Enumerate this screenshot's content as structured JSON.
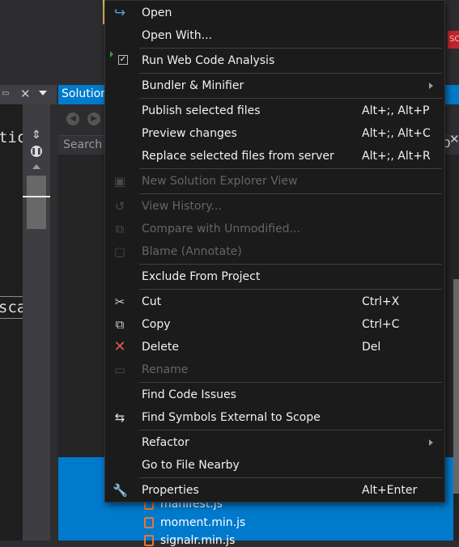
{
  "background": {
    "top_tab_label": "SC",
    "solution_explorer_title": "Solution",
    "search_placeholder": "Search S",
    "editor_text_1": "tic",
    "editor_text_2": "sca",
    "right_char": "p",
    "files": [
      "manifest.js",
      "moment.min.js",
      "signalr.min.js"
    ]
  },
  "menu": {
    "items": [
      {
        "id": "open",
        "label": "Open",
        "icon": "open-arrow-icon",
        "enabled": true
      },
      {
        "id": "open-with",
        "label": "Open With...",
        "enabled": true
      },
      {
        "id": "run-web-code-analysis",
        "label": "Run Web Code Analysis",
        "icon": "checkbox-icon",
        "enabled": true
      },
      {
        "id": "bundler-minifier",
        "label": "Bundler & Minifier",
        "submenu": true,
        "enabled": true
      },
      {
        "id": "publish-selected-files",
        "label": "Publish selected files",
        "shortcut": "Alt+;, Alt+P",
        "enabled": true
      },
      {
        "id": "preview-changes",
        "label": "Preview changes",
        "shortcut": "Alt+;, Alt+C",
        "enabled": true
      },
      {
        "id": "replace-selected-files",
        "label": "Replace selected files from server",
        "shortcut": "Alt+;, Alt+R",
        "enabled": true
      },
      {
        "id": "new-solution-explorer-view",
        "label": "New Solution Explorer View",
        "icon": "new-view-icon",
        "enabled": false
      },
      {
        "id": "view-history",
        "label": "View History...",
        "icon": "history-icon",
        "enabled": false
      },
      {
        "id": "compare-with-unmodified",
        "label": "Compare with Unmodified...",
        "icon": "compare-icon",
        "enabled": false
      },
      {
        "id": "blame",
        "label": "Blame (Annotate)",
        "icon": "blame-icon",
        "enabled": false
      },
      {
        "id": "exclude-from-project",
        "label": "Exclude From Project",
        "enabled": true
      },
      {
        "id": "cut",
        "label": "Cut",
        "shortcut": "Ctrl+X",
        "icon": "scissors-icon",
        "enabled": true
      },
      {
        "id": "copy",
        "label": "Copy",
        "shortcut": "Ctrl+C",
        "icon": "copy-icon",
        "enabled": true
      },
      {
        "id": "delete",
        "label": "Delete",
        "shortcut": "Del",
        "icon": "delete-x-icon",
        "enabled": true
      },
      {
        "id": "rename",
        "label": "Rename",
        "icon": "rename-icon",
        "enabled": false
      },
      {
        "id": "find-code-issues",
        "label": "Find Code Issues",
        "enabled": true
      },
      {
        "id": "find-symbols-external",
        "label": "Find Symbols External to Scope",
        "icon": "find-symbols-icon",
        "enabled": true
      },
      {
        "id": "refactor",
        "label": "Refactor",
        "submenu": true,
        "enabled": true
      },
      {
        "id": "go-to-file-nearby",
        "label": "Go to File Nearby",
        "enabled": true
      },
      {
        "id": "properties",
        "label": "Properties",
        "shortcut": "Alt+Enter",
        "icon": "wrench-icon",
        "enabled": true
      }
    ]
  },
  "colors": {
    "accent": "#007acc",
    "menu_bg": "#1b1b1c",
    "delete_icon": "#e05a4f",
    "disabled_text": "#656565"
  }
}
